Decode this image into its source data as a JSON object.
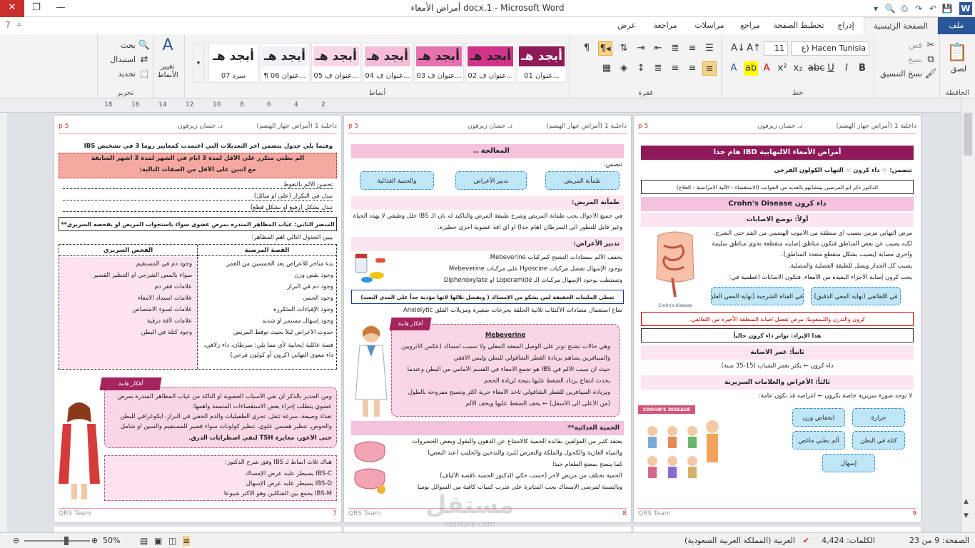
{
  "window": {
    "title": "أمراض الأمعاء  docx.1 - Microsoft Word",
    "controls": {
      "minimize": "—",
      "restore": "❐",
      "close": "✕",
      "help": "?"
    }
  },
  "tabs": [
    {
      "label": "ملف"
    },
    {
      "label": "الصفحة الرئيسية"
    },
    {
      "label": "إدراج"
    },
    {
      "label": "تخطيط الصفحة"
    },
    {
      "label": "مراجع"
    },
    {
      "label": "مراسلات"
    },
    {
      "label": "مراجعة"
    },
    {
      "label": "عرض"
    }
  ],
  "ribbon": {
    "clipboard": {
      "label": "الحافظة",
      "paste": "لصق",
      "cut": "قص",
      "copy": "نسخ",
      "format_painter": "نسخ التنسيق"
    },
    "font": {
      "label": "خط",
      "name": "Hacen Tunisia (ع",
      "size": "11"
    },
    "paragraph": {
      "label": "فقرة"
    },
    "styles": {
      "label": "أنماط",
      "items": [
        {
          "preview": "أبجد هـ",
          "name": "01 عنوان..."
        },
        {
          "preview": "أبجد هـ",
          "name": "02 عنوان ف..."
        },
        {
          "preview": "أبجد هـ",
          "name": "03 عنوان ف..."
        },
        {
          "preview": "أبجد هـ",
          "name": "04 عنوان ف..."
        },
        {
          "preview": "أبجد هـ",
          "name": "05 عنوان ف..."
        },
        {
          "preview": "أبجد هـ",
          "name": "¶ 06 عنوان..."
        },
        {
          "preview": "أبجد هـ",
          "name": "07 سرد"
        }
      ],
      "change_styles": "تغيير الأنماط"
    },
    "editing": {
      "label": "تحرير",
      "find": "بحث",
      "replace": "استبدال",
      "select": "تحديد"
    }
  },
  "ruler": {
    "numbers": [
      "2",
      "4",
      "6",
      "8",
      "10",
      "12",
      "14",
      "16",
      "18"
    ]
  },
  "pages": {
    "header_author": "د. حسان زيزفون",
    "header_course": "داخلية 1 (أمراض جهاز الهضم)",
    "header_mark": "p 5",
    "footer": "QRS Team",
    "p9": {
      "number": "9",
      "title": "أمراض الأمعاء الالتهابية IBD هام جدا",
      "includes": "تتضمن:",
      "types": "☜ داء كرون       ☜ التهاب الكولون القرحي",
      "doctor_note": "الدكتور ذكر انو المرضين بيتشابهو بالعديد من الجوانب (الاستقصاء - الآلية الامراضية - العلاج)",
      "crohn_title": "داء كرون Crohn's Disease",
      "loc_title": "أولاً: توضع الاصابات",
      "b1": "مرض التهابي مزمن يصيب أي منطقة من الأنبوب الهضمي من الفم حتى الشرج.",
      "b2": "لكنه يصيب عن بعض المناطق فتكون مناطق إصابته متقطعة تحوي مناطق سليمة",
      "b3": "وأخرى مصابة (يصيب بشكل متقطع متعدد المناطق).",
      "b4": "يصيب كل الجدار ويصل للطبقة العضلية والمصلية.",
      "b5": "يحب كرون إصابة الأجزاء البعيدة من الأمعاء، فتكون الاصابات أعظمية في:",
      "chip_a": "في اللفائفي (نهاية المعي الدقيق)",
      "chip_b": "في القناة الشرجية (نهاية المعي الغليظ)",
      "warn": "كرون والتدرن والليمفوما: مرض تفضل اصابة المنطقة الأخيرة من اللفائفي.",
      "bold_note": "هذا الإيراد: تواتر داء كرون حالياً",
      "age_title": "ثانياً: عمر الاصابة",
      "age_text": "داء كرون ← يكثر بعمر الشباب (15-35 سنة)",
      "sym_title": "ثالثاً: الأعراض والعلامات السريرية",
      "sym_text": "لا توجد صورة سريرية خاصة بكرون ← أعراضه قد تكون عامة:",
      "chips": [
        "حرارة",
        "انخفاض وزن",
        "ألم بطني ماغص",
        "كتلة في البطن",
        "إسهال"
      ],
      "fig_label": "CROHN'S DISEASE",
      "fig_caption": "Crohn's disease"
    },
    "p8": {
      "number": "8",
      "treat_title": "المعالجة ..",
      "includes": "تتضمن:",
      "chips": [
        "طمأنة المريض",
        "تدبير الأعراض",
        "والحمية الغذائية"
      ],
      "reassure_title": "طمأنة المريض:",
      "r1": "في جميع الأحوال يجب طمأنة المريض وشرح طبيعة المرض والتأكيد له بأن الـ IBS خلل وظيفي لا يهدد الحياة",
      "r2": "وغير قابل للتطور الى السرطان (هام جداً) أو أي آفة عضوية أخرى خطيرة.",
      "sym_title": "تدبير الأعراض:",
      "s1": "يخفف الألم بمضادات التشنج كمركبات Mebeverine",
      "s2": "يوجود الإسهال تفضل مركبات Hyoscine على مركبات Mebeverine",
      "s3": "وتستطب بوجود الإسهال مركبات الـ Loperamide أو Diphenoxylate",
      "boxed": "تعطى الملينات الخفيفة لمن يشكو من الإمساك ( ويفضل بلالها لانها مؤذية جداً على المدى البعيد)",
      "s4": "شاع استعمال مضادات الاكتئاب ثلاثية الحلقة بجرعات صغيرة ومزيلات القلق Anxiolytic",
      "tag": "أفكار هامة",
      "mebe_title": "Mebeverine",
      "m1": "وهي حالات تشنج توتر على الوصل المعقد المعلي ولا تسبب امساك (عكس الأتروبين)",
      "m2": "والميبافرين يساهم بزيادة القطر الشاقولي للبطن وليس الأفقي",
      "m3": "حيث أن سبب الألم في IBS هو تجمع الأمعاء في القسم الأمامي من البطن وعندما",
      "m4": "يحدث انتفاخ يزداد الضغط عليها نتيجة لزيادة الحجم",
      "m5": "وبزيادة الميبافرين للقطر الشاقولي تأخذ الأمعاء حرية أكثر وتصبح مفروحة بالطول",
      "m6": "(من الأعلى الى الأسفل) ← يخف الضغط عليها ويخف الألم",
      "diet_title": "الحمية الغذائية**",
      "d1": "يعتقد كثير من المؤلفين بفائدة الحمية كالامتناع عن الدهون والبقول وبعض الخضروات",
      "d2": "والمياه الغازية والكحول والملكة والتعرض للبرد والتدخين والحليب (عند البعض)",
      "d3": "كما ينصح بمضغ الطعام جيداً",
      "d4": "الحمية تختلف من مريض لآخر (حسب حكي الدكتور الحمية ناقصة الألياف)",
      "d5": "وبالنسبة لمرضى الإمساك يجب المثابرة على شرب كميات كافية من السوائل يومياً"
    },
    "p7": {
      "number": "7",
      "intro": "وفيما يلي جدول يتضمن آخر التعديلات التي اعتمدت كمعايير روما 3 في تشخيص IBS",
      "criteria": "ألم بطني متكرر على الأقل لمدة 3 أيام في الشهر لمدة 3 أشهر السابقة",
      "criteria2": "مع اثنين على الأقل من الصفات التالية:",
      "c1": "تحسن الألم بالتغوط",
      "c2": "تبدل في التكرار (على أو سائل)",
      "c3": "تبدل بشكل (رفيع أو بشكل قطع)",
      "second": "المنصر الثاني: غياب المظاهر المنذرة بمرض عضوي سواء باستجواب المريض او بفحصه السريري**",
      "table_intro": "يبين الجدول التالي أهم المظاهر:",
      "col_a": "القصة المرضية",
      "col_b": "الفحص السريري",
      "rows_a": [
        "بدء متأخر للأعراض بعد الخمسين من العمر",
        "وجود نقص وزن",
        "وجود دم في البراز",
        "وجود الحمى",
        "وجود الإقياءات المتكررة",
        "وجود إسهال مستمر أو شديد",
        "حدوث الأعراض ليلاً بحيث توقظ المريض",
        "قصة عائلية إيجابية لأي مما يلي: سرطان، داء زلاقي، داء معوي التهابي (كرون أو كولون قرحي)"
      ],
      "rows_b": [
        "وجود دم في المستقيم",
        "سواء بالمس الشرجي أو التنظير القصير",
        "علامات فقر دم",
        "علامات انسداد الأمعاء",
        "علامات لسوء الامتصاص",
        "علامات لآفة درقية",
        "وجود كتلة في البطن"
      ],
      "tag": "أفكار هامة",
      "call1": "ومن الجدير بالذكر أن نفي الأسباب العضوية أو التأكد من غياب المظاهر المنذرة بمرض",
      "call2": "عضوي يتطلب إجراء بعض الاستقصاءات المتممة وأهمها:",
      "call3": "تعداد وصيغة، سرعة تثفل، تحري الطفيليات والدم الخفي في البراز، ايكوغرافي للبطن",
      "call4": "والحوض، تنظير هضمي علوي، تنظير كولونات سواء قصير للمستقيم والسين أو شامل",
      "call5": "حتى الأعور، معايرة TSH لنفي اضطرابات الدرق.",
      "types_intro": "هناك ثلاث أنماط لـ IBS وفق شرح الدكتور:",
      "t1": "IBS-C يسيطر عليه عرض الإمساك",
      "t2": "IBS-D يسيطر عليه عرض الإسهال",
      "t3": "IBS-M يجمع بين الشكلين وهو الأكثر شيوعاً"
    }
  },
  "watermark": {
    "main": "مستقل",
    "sub": "mostaql.com"
  },
  "status": {
    "page": "الصفحة: 9 من 23",
    "words": "الكلمات: 4,424",
    "language": "العربية (المملكة العربية السعودية)",
    "zoom": "50%"
  }
}
